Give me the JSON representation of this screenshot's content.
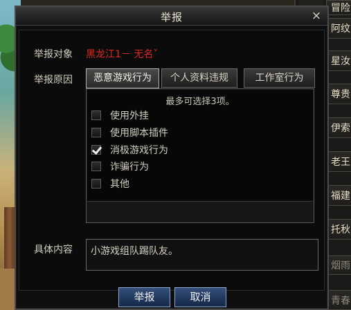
{
  "dialog": {
    "title": "举报",
    "close": "×",
    "target_label": "举报对象",
    "target_name": "黑龙江1－ 无名ˇ",
    "reason_label": "举报原因",
    "tabs": [
      {
        "label": "恶意游戏行为",
        "active": true
      },
      {
        "label": "个人资料违规",
        "active": false
      },
      {
        "label": "工作室行为",
        "active": false
      }
    ],
    "hint": "最多可选择3项。",
    "options": [
      {
        "label": "使用外挂",
        "checked": false
      },
      {
        "label": "使用脚本插件",
        "checked": false
      },
      {
        "label": "消极游戏行为",
        "checked": true
      },
      {
        "label": "诈骗行为",
        "checked": false
      },
      {
        "label": "其他",
        "checked": false
      }
    ],
    "content_label": "具体内容",
    "content_value": "小游戏组队踢队友。",
    "submit_label": "举报",
    "cancel_label": "取消"
  },
  "side_list": [
    {
      "label": "冒险"
    },
    {
      "label": "阿纹"
    },
    {
      "label": "星汝"
    },
    {
      "label": "尊贵"
    },
    {
      "label": "伊索"
    },
    {
      "label": "老王"
    },
    {
      "label": "福建"
    },
    {
      "label": "托秋"
    },
    {
      "label": "烟雨"
    },
    {
      "label": "青春"
    }
  ],
  "colors": {
    "target_name": "#e0281f",
    "button_bg": "#223a61",
    "button_border": "#8ea7cc"
  }
}
